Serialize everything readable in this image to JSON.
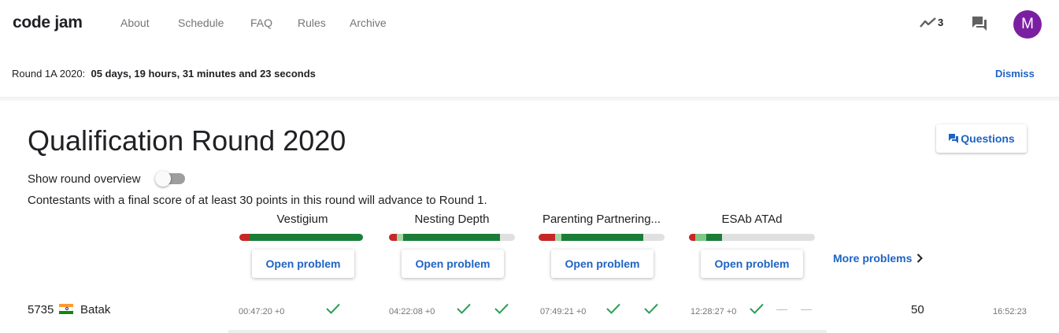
{
  "app": {
    "logo": "code jam"
  },
  "nav": [
    "About",
    "Schedule",
    "FAQ",
    "Rules",
    "Archive"
  ],
  "header": {
    "trend_count": "3",
    "avatar_letter": "M",
    "avatar_color": "#7b1fa2"
  },
  "notice": {
    "label": "Round 1A 2020:",
    "countdown": "05 days, 19 hours, 31 minutes and 23 seconds",
    "dismiss": "Dismiss"
  },
  "round": {
    "title": "Qualification Round 2020",
    "questions_label": "Questions",
    "overview_label": "Show round overview",
    "overview_on": false,
    "advance_text": "Contestants with a final score of at least 30 points in this round will advance to Round 1."
  },
  "problems": [
    {
      "name": "Vestigium",
      "open_label": "Open problem"
    },
    {
      "name": "Nesting Depth",
      "open_label": "Open problem"
    },
    {
      "name": "Parenting Partnering...",
      "open_label": "Open problem"
    },
    {
      "name": "ESAb ATAd",
      "open_label": "Open problem"
    }
  ],
  "more_problems": "More problems",
  "colors": {
    "accent": "#1e63c4",
    "bar_wrong": "#c62828",
    "bar_partial": "#81c784",
    "bar_correct": "#1b7e38",
    "bar_empty": "#e0e0e0",
    "check": "#2e9e55"
  },
  "row": {
    "rank": "5735",
    "name": "Batak",
    "times": [
      "00:47:20 +0",
      "04:22:08 +0",
      "07:49:21 +0",
      "12:28:27 +0"
    ],
    "score": "50",
    "penalty": "16:52:23"
  }
}
